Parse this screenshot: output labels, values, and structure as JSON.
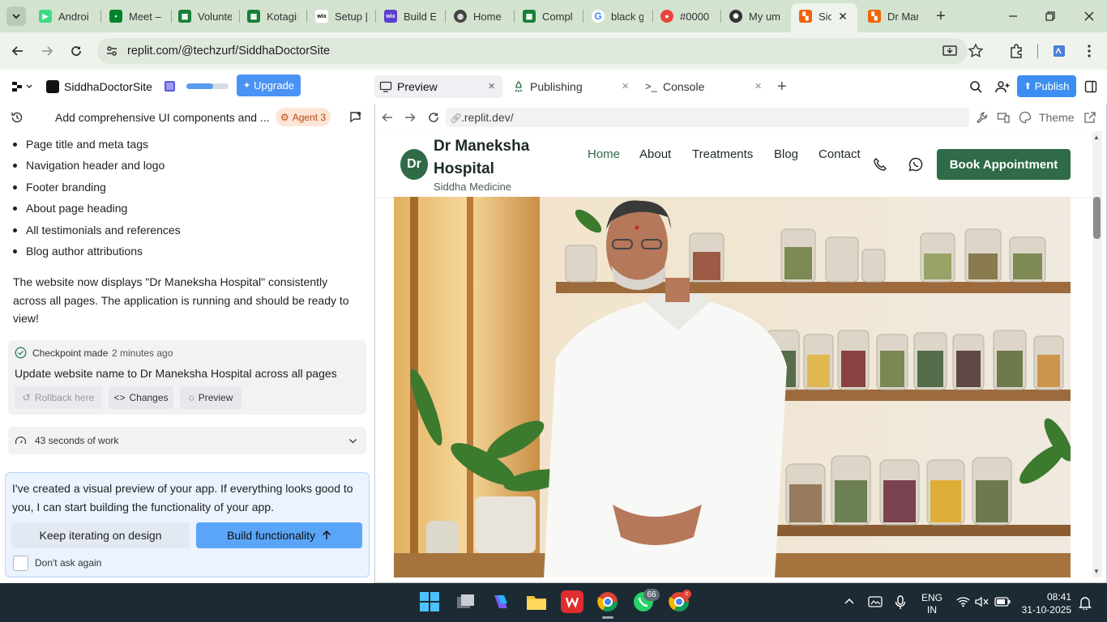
{
  "browser": {
    "tabs": [
      {
        "label": "Androi",
        "icon": "android-studio-icon"
      },
      {
        "label": "Meet –",
        "icon": "google-meet-icon"
      },
      {
        "label": "Volunte",
        "icon": "sheets-icon"
      },
      {
        "label": "Kotagir",
        "icon": "sheets-icon"
      },
      {
        "label": "Setup |",
        "icon": "wix-icon"
      },
      {
        "label": "Build E",
        "icon": "wix-studio-icon"
      },
      {
        "label": "Home |",
        "icon": "globe-icon"
      },
      {
        "label": "Compl",
        "icon": "sheets-icon"
      },
      {
        "label": "black g",
        "icon": "google-icon"
      },
      {
        "label": "#0000",
        "icon": "color-icon"
      },
      {
        "label": "My um",
        "icon": "openai-icon"
      },
      {
        "label": "Sic",
        "icon": "replit-icon"
      },
      {
        "label": "Dr Mar",
        "icon": "replit-icon"
      }
    ],
    "url": "replit.com/@techzurf/SiddhaDoctorSite"
  },
  "replit": {
    "project_name": "SiddhaDoctorSite",
    "upgrade_label": "Upgrade",
    "thread_title": "Add comprehensive UI components and ...",
    "agent_badge": "Agent 3",
    "tabs": [
      {
        "label": "Preview"
      },
      {
        "label": "Publishing"
      },
      {
        "label": "Console"
      }
    ],
    "publish_label": "Publish"
  },
  "chat": {
    "bullets": [
      "Page title and meta tags",
      "Navigation header and logo",
      "Footer branding",
      "About page heading",
      "All testimonials and references",
      "Blog author attributions"
    ],
    "message_line1": "The website now displays \"Dr Maneksha Hospital\" consistently",
    "message_line2": "across all pages. The application is running and should be ready to",
    "message_line3": "view!",
    "checkpoint": {
      "label": "Checkpoint made",
      "time": "2 minutes ago",
      "title": "Update website name to Dr Maneksha Hospital across all pages",
      "rollback": "Rollback here",
      "changes": "Changes",
      "preview": "Preview"
    },
    "work_summary": "43 seconds of work",
    "prompt_line1": "I've created a visual preview of your app. If everything looks good to",
    "prompt_line2": "you, I can start building the functionality of your app.",
    "keep_iterating": "Keep iterating on design",
    "build_functionality": "Build functionality",
    "dont_ask": "Don't ask again"
  },
  "preview": {
    "url": ".replit.dev/",
    "theme_label": "Theme",
    "site": {
      "logo_text": "Dr",
      "name_line1": "Dr Maneksha",
      "name_line2": "Hospital",
      "subtitle": "Siddha Medicine",
      "nav": [
        "Home",
        "About",
        "Treatments",
        "Blog",
        "Contact"
      ],
      "book_label": "Book Appointment"
    }
  },
  "taskbar": {
    "lang_line1": "ENG",
    "lang_line2": "IN",
    "time": "08:41",
    "date": "31-10-2025",
    "whatsapp_badge": "66"
  },
  "colors": {
    "accent_green": "#2e6b46",
    "publish_blue": "#3c8ff0",
    "upgrade_blue": "#4a93f5",
    "chrome_green": "#d3e3cf"
  }
}
